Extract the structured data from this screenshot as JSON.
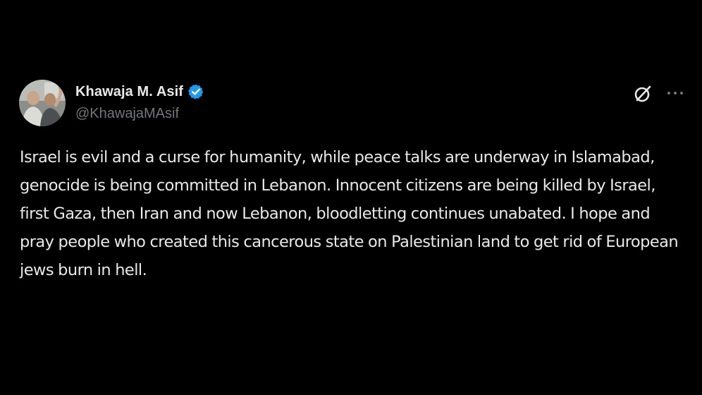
{
  "tweet": {
    "author": {
      "display_name": "Khawaja M. Asif",
      "handle": "@KhawajaMAsif",
      "verified": true,
      "verified_color": "#1d9bf0"
    },
    "text": "Israel is evil and a curse for humanity, while peace talks are underway in Islamabad, genocide is being committed in Lebanon. Innocent citizens are being killed by Israel, first Gaza, then Iran and now Lebanon, bloodletting continues unabated. I hope and pray people who created this cancerous state on Palestinian land to get rid of European jews burn in hell.",
    "actions": {
      "grok_icon": "grok-icon",
      "more_icon": "more-icon"
    }
  },
  "colors": {
    "background": "#000000",
    "text_primary": "#e7e9ea",
    "text_secondary": "#71767b"
  }
}
